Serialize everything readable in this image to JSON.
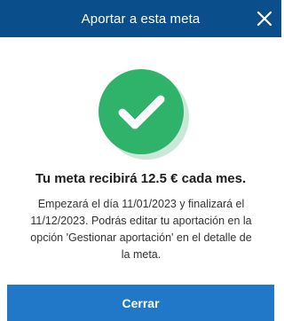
{
  "header": {
    "title": "Aportar a esta meta",
    "close_icon": "close-icon"
  },
  "status": {
    "icon": "check-circle-icon",
    "icon_color": "#2fb26a",
    "shadow_color": "#c9e9d6"
  },
  "message": {
    "headline": "Tu meta recibirá 12.5 € cada mes.",
    "description": "Empezará el día 11/01/2023 y finalizará el 11/12/2023. Podrás editar tu aportación en la opción 'Gestionar aportación' en el detalle de la meta."
  },
  "actions": {
    "close_label": "Cerrar"
  },
  "colors": {
    "header_bg": "#0a4f8c",
    "button_bg": "#2278c8",
    "text": "#1d1d1d"
  }
}
